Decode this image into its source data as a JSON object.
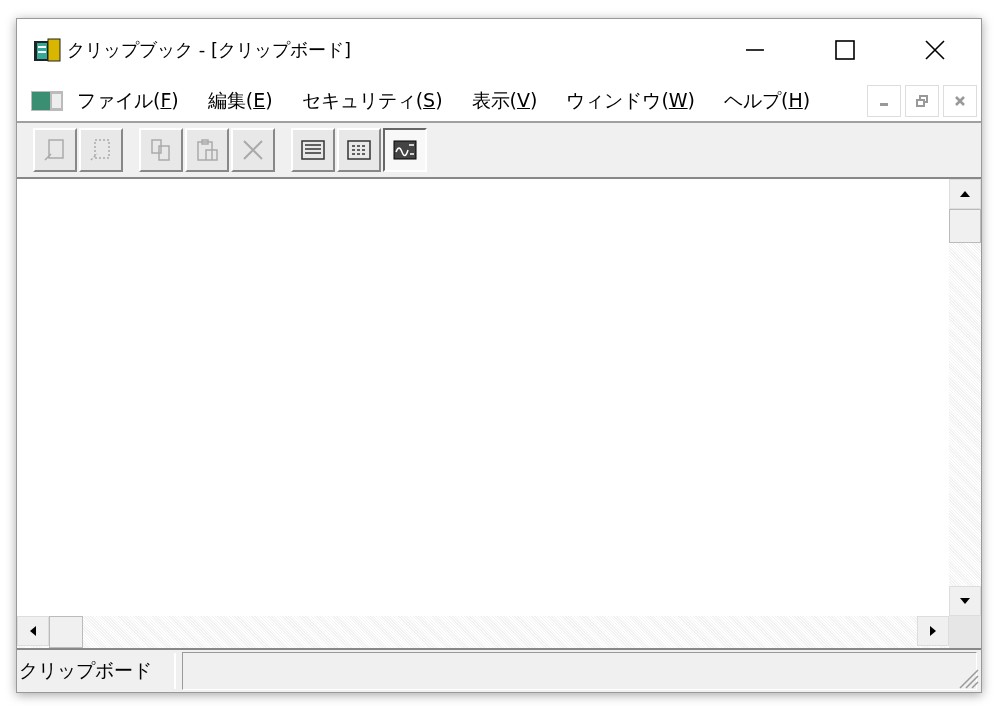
{
  "window": {
    "title": "クリップブック - [クリップボード]"
  },
  "menu": [
    {
      "before": "ファイル(",
      "key": "F",
      "after": ")"
    },
    {
      "before": "編集(",
      "key": "E",
      "after": ")"
    },
    {
      "before": "セキュリティ(",
      "key": "S",
      "after": ")"
    },
    {
      "before": "表示(",
      "key": "V",
      "after": ")"
    },
    {
      "before": "ウィンドウ(",
      "key": "W",
      "after": ")"
    },
    {
      "before": "ヘルプ(",
      "key": "H",
      "after": ")"
    }
  ],
  "toolbar": [
    [
      {
        "disabled": true,
        "selected": false
      },
      {
        "disabled": true,
        "selected": false
      }
    ],
    [
      {
        "disabled": true,
        "selected": false
      },
      {
        "disabled": true,
        "selected": false
      },
      {
        "disabled": true,
        "selected": false
      }
    ],
    [
      {
        "disabled": false,
        "selected": false
      },
      {
        "disabled": false,
        "selected": false
      },
      {
        "disabled": false,
        "selected": true
      }
    ]
  ],
  "status_bar": {
    "text": "クリップボード"
  }
}
